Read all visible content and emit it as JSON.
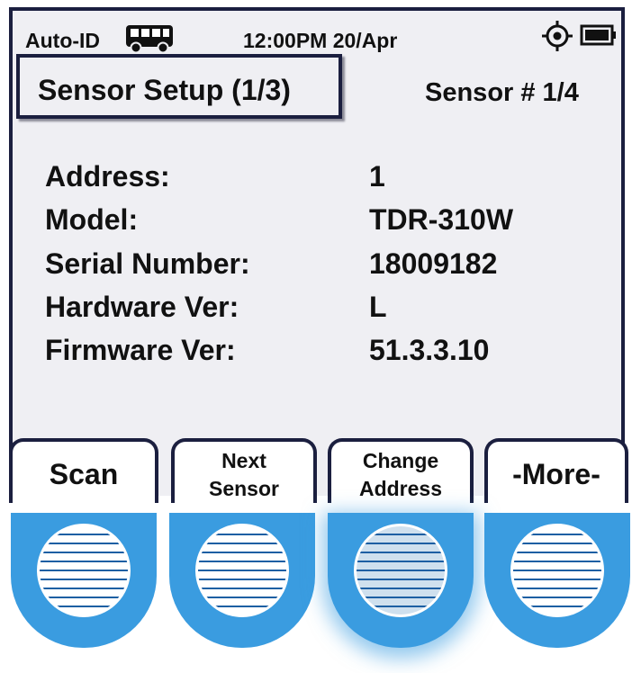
{
  "status_bar": {
    "mode": "Auto-ID",
    "time_date": "12:00PM 20/Apr",
    "icons": [
      "bus-icon",
      "target-icon",
      "battery-icon"
    ]
  },
  "header": {
    "title": "Sensor Setup (1/3)",
    "sensor_number": "Sensor # 1/4"
  },
  "details": {
    "rows": [
      {
        "label": "Address:",
        "value": "1"
      },
      {
        "label": "Model:",
        "value": "TDR-310W"
      },
      {
        "label": "Serial Number:",
        "value": "18009182"
      },
      {
        "label": "Hardware Ver:",
        "value": "L"
      },
      {
        "label": "Firmware Ver:",
        "value": "51.3.3.10"
      }
    ]
  },
  "softkeys": [
    {
      "line1": "Scan"
    },
    {
      "line1": "Next",
      "line2": "Sensor"
    },
    {
      "line1": "Change",
      "line2": "Address"
    },
    {
      "line1": "-More-"
    }
  ],
  "colors": {
    "screen_bg": "#efeff3",
    "frame": "#1b1f3f",
    "button_blue": "#3a9ce0",
    "grille_line": "#1d5fa3"
  }
}
